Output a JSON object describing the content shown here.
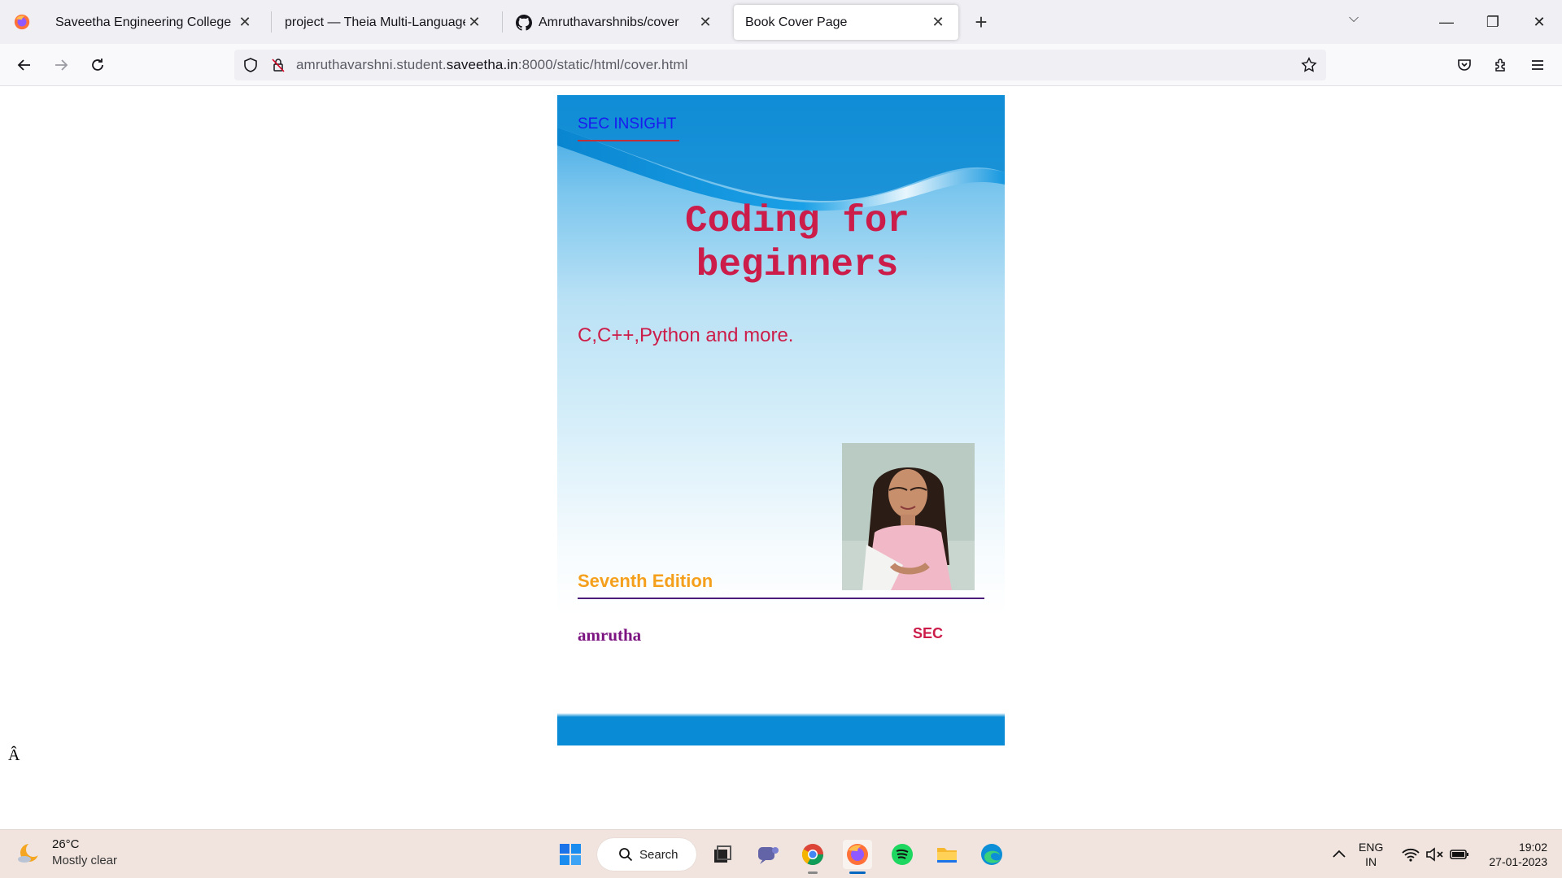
{
  "browser": {
    "tabs": [
      {
        "title": "Saveetha Engineering College",
        "active": false
      },
      {
        "title": "project — Theia Multi-Language Ex",
        "active": false
      },
      {
        "title": "Amruthavarshnibs/cover",
        "active": false
      },
      {
        "title": "Book Cover Page",
        "active": true
      }
    ],
    "url": {
      "prefix": "amruthavarshni.student.",
      "host": "saveetha.in",
      "suffix": ":8000/static/html/cover.html"
    }
  },
  "page": {
    "stray_char": "Â",
    "cover": {
      "brand": "SEC INSIGHT",
      "title_line1": "Coding for",
      "title_line2": "beginners",
      "subtitle": "C,C++,Python and more.",
      "edition": "Seventh Edition",
      "author": "amrutha",
      "publisher": "SEC"
    }
  },
  "taskbar": {
    "weather": {
      "temp": "26°C",
      "desc": "Mostly clear"
    },
    "search_label": "Search",
    "lang_line1": "ENG",
    "lang_line2": "IN",
    "time": "19:02",
    "date": "27-01-2023"
  }
}
